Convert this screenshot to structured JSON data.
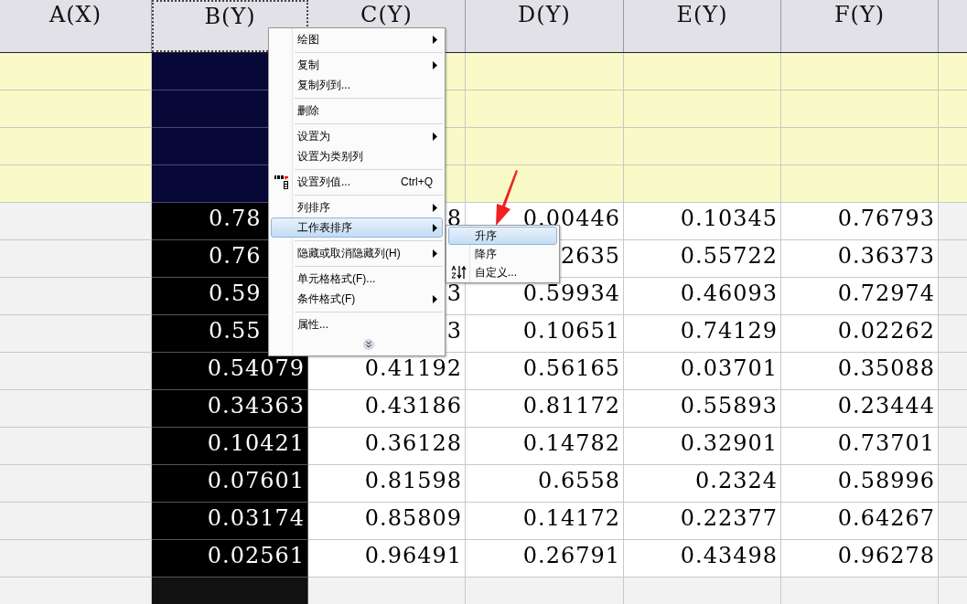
{
  "columns": [
    {
      "label": "A(X)",
      "selected": false
    },
    {
      "label": "B(Y)",
      "selected": true
    },
    {
      "label": "C(Y)",
      "selected": false
    },
    {
      "label": "D(Y)",
      "selected": false
    },
    {
      "label": "E(Y)",
      "selected": false
    },
    {
      "label": "F(Y)",
      "selected": false
    }
  ],
  "rows": [
    {
      "first_cell_clipped": true,
      "cells": [
        "0.78",
        "8",
        "0.00446",
        "0.10345",
        "0.76793"
      ]
    },
    {
      "first_cell_clipped": true,
      "cells": [
        "0.76",
        null,
        "2635",
        "0.55722",
        "0.36373"
      ]
    },
    {
      "first_cell_clipped": true,
      "cells": [
        "0.59",
        "3",
        "0.59934",
        "0.46093",
        "0.72974"
      ]
    },
    {
      "first_cell_clipped": true,
      "cells": [
        "0.55",
        "3",
        "0.10651",
        "0.74129",
        "0.02262"
      ]
    },
    {
      "first_cell_clipped": false,
      "cells": [
        "0.54079",
        "0.41192",
        "0.56165",
        "0.03701",
        "0.35088"
      ]
    },
    {
      "first_cell_clipped": false,
      "cells": [
        "0.34363",
        "0.43186",
        "0.81172",
        "0.55893",
        "0.23444"
      ]
    },
    {
      "first_cell_clipped": false,
      "cells": [
        "0.10421",
        "0.36128",
        "0.14782",
        "0.32901",
        "0.73701"
      ]
    },
    {
      "first_cell_clipped": false,
      "cells": [
        "0.07601",
        "0.81598",
        "0.6558",
        "0.2324",
        "0.58996"
      ]
    },
    {
      "first_cell_clipped": false,
      "cells": [
        "0.03174",
        "0.85809",
        "0.14172",
        "0.22377",
        "0.64267"
      ]
    },
    {
      "first_cell_clipped": false,
      "cells": [
        "0.02561",
        "0.96491",
        "0.26791",
        "0.43498",
        "0.96278"
      ]
    }
  ],
  "context_menu": [
    {
      "kind": "item",
      "label": "绘图",
      "submenu": true,
      "selected": false
    },
    {
      "kind": "separator"
    },
    {
      "kind": "item",
      "label": "复制",
      "submenu": true,
      "selected": false
    },
    {
      "kind": "item",
      "label": "复制列到...",
      "submenu": false,
      "selected": false
    },
    {
      "kind": "separator"
    },
    {
      "kind": "item",
      "label": "删除",
      "submenu": false,
      "selected": false
    },
    {
      "kind": "separator"
    },
    {
      "kind": "item",
      "label": "设置为",
      "submenu": true,
      "selected": false
    },
    {
      "kind": "item",
      "label": "设置为类别列",
      "submenu": false,
      "selected": false
    },
    {
      "kind": "separator"
    },
    {
      "kind": "icon_item",
      "label": "设置列值...",
      "shortcut": "Ctrl+Q",
      "submenu": false,
      "selected": false
    },
    {
      "kind": "separator"
    },
    {
      "kind": "item",
      "label": "列排序",
      "submenu": true,
      "selected": false
    },
    {
      "kind": "item",
      "label": "工作表排序",
      "submenu": true,
      "selected": true
    },
    {
      "kind": "separator"
    },
    {
      "kind": "item",
      "label": "隐藏或取消隐藏列(H)",
      "submenu": true,
      "selected": false
    },
    {
      "kind": "separator"
    },
    {
      "kind": "item",
      "label": "单元格格式(F)...",
      "submenu": false,
      "selected": false
    },
    {
      "kind": "item",
      "label": "条件格式(F)",
      "submenu": true,
      "selected": false
    },
    {
      "kind": "separator"
    },
    {
      "kind": "item",
      "label": "属性...",
      "submenu": false,
      "selected": false
    },
    {
      "kind": "expand"
    }
  ],
  "submenu": [
    {
      "kind": "item",
      "label": "升序",
      "selected": true
    },
    {
      "kind": "item",
      "label": "降序",
      "selected": false
    },
    {
      "kind": "icon_item",
      "label": "自定义...",
      "selected": false
    }
  ]
}
